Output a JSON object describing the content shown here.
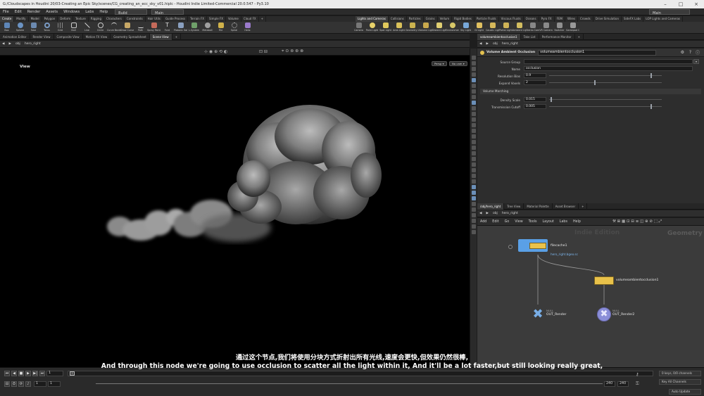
{
  "titlebar": {
    "title": "G:/Cloudscapes in Houdini 20/03-Creating an Epic Sky/scenes/CG_creating_an_ecc_sky_v01.hiplc - Houdini Indie Limited-Commercial 20.0.547 - Py3.10"
  },
  "menu": {
    "items": [
      "File",
      "Edit",
      "Render",
      "Assets",
      "Windows",
      "Labs",
      "Help"
    ],
    "desktop": "Build",
    "main": "Main",
    "right_desktop": "Main"
  },
  "shelf_tabs_left": [
    "Create",
    "Modify",
    "Model",
    "Polygon",
    "Deform",
    "Texture",
    "Rigging",
    "Characters",
    "Constraints",
    "Hair Utils",
    "Guide Process",
    "Terrain FX",
    "Simple FX",
    "Volume",
    "Cloud FX"
  ],
  "shelf_tabs_right": [
    "Lights and Cameras",
    "Collisions",
    "Particles",
    "Grains",
    "Vellum",
    "Rigid Bodies",
    "Particle Fluids",
    "Viscous Fluids",
    "Oceans",
    "Pyro FX",
    "FEM",
    "Wires",
    "Crowds",
    "Drive Simulation",
    "SideFX Labs",
    "LOP Lights and Cameras"
  ],
  "shelf_tools_left": [
    "Box",
    "Sphere",
    "Tube",
    "Torus",
    "Grid",
    "Null",
    "Line",
    "Circle",
    "Curve Bezier",
    "Draw Curve",
    "Path",
    "Spray Paint",
    "Font",
    "Platonic Solids",
    "L-System",
    "Metaball",
    "File",
    "Spiral",
    "Helix"
  ],
  "shelf_tools_right": [
    "Camera",
    "Point Light",
    "Spot Light",
    "Area Light",
    "Geometry Light",
    "Volume Light",
    "Distant Light",
    "Environment Light",
    "Sky Light",
    "GI Light",
    "Caustic Light",
    "Portal Light",
    "Ambient Light",
    "Stereo Camera",
    "VR Camera",
    "Switcher",
    "Gamepad Camera"
  ],
  "left_pane_tabs": [
    "Animation Editor",
    "Render View",
    "Composite View",
    "Motion FX View",
    "Geometry Spreadsheet",
    "Scene View"
  ],
  "left_path": [
    "obj",
    "hero_right"
  ],
  "viewport": {
    "label": "View",
    "persp": "Persp",
    "cam": "No cam"
  },
  "right_top_tabs": [
    "volumeambientocclusion1",
    "Take List",
    "Performance Monitor"
  ],
  "right_path": [
    "obj",
    "hero_right"
  ],
  "params": {
    "node_type": "Volume Ambient Occlusion",
    "node_name": "volumeambientocclusion1",
    "source_group_label": "Source Group",
    "source_group_value": "",
    "name_label": "Name",
    "name_value": "occlusion",
    "resolution_label": "Resolution Bias",
    "resolution_value": "0.9",
    "resolution_fraction": 0.9,
    "expand_label": "Expand Voxels",
    "expand_value": "2",
    "expand_fraction": 0.4,
    "section_volume_marching": "Volume Marching",
    "density_label": "Density Scale",
    "density_value": "0.015",
    "density_fraction": 0.015,
    "transmission_label": "Transmission Cutoff",
    "transmission_value": "0.005",
    "transmission_fraction": 0.9
  },
  "right_bottom_tabs": [
    "/obj/hero_right",
    "Tree View",
    "Material Palette",
    "Asset Browser"
  ],
  "network": {
    "menu": [
      "Add",
      "Edit",
      "Go",
      "View",
      "Tools",
      "Layout",
      "Labs",
      "Help"
    ],
    "watermark": "Indie Edition",
    "context": "Geometry",
    "filecache_name": "filecache1",
    "filecache_sub": "hero_right.bgeo.sc",
    "vao_name": "volumeambientocclusion1",
    "out1_type": "NULL",
    "out1_name": "OUT_Render",
    "out2_type": "NULL",
    "out2_name": "OUT_Render2"
  },
  "timeline": {
    "frame": "1",
    "start": "1",
    "range_start": "1",
    "range_end_a": "240",
    "range_end_b": "240",
    "keys_info": "0 keys, 0/0 channels",
    "key_all": "Key All Channels",
    "auto_update": "Auto Update"
  },
  "subtitles": {
    "cn": "通过这个节点,我们将使用分块方式折射出所有光线,速度会更快,但效果仍然很棒,",
    "en": "And through this node we're going to use occlusion to scatter all the light within it, And it'll be a lot faster,but still looking really great,"
  },
  "colors": {
    "accent_yellow": "#e9c24a",
    "node_blue": "#5aa0e6",
    "link_blue": "#56a8e8"
  }
}
